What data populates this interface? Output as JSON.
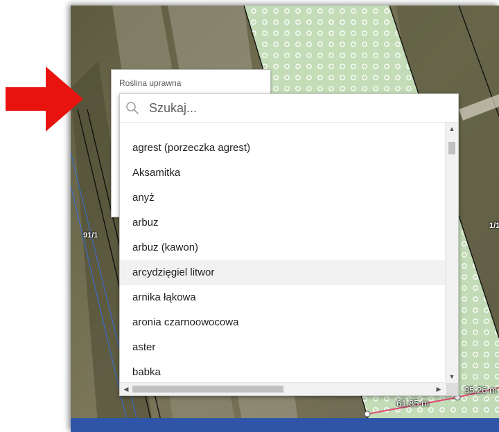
{
  "map": {
    "parcel_labels": [
      "91/1",
      "1/1"
    ],
    "measure_labels": [
      "61.85 m",
      "35.26 m"
    ]
  },
  "crop_field": {
    "label": "Roślina uprawna"
  },
  "dropdown": {
    "search_placeholder": "Szukaj...",
    "options": [
      "agrest (porzeczka agrest)",
      "Aksamitka",
      "anyż",
      "arbuz",
      "arbuz (kawon)",
      "arcydzięgiel litwor",
      "arnika łąkowa",
      "aronia czarnoowocowa",
      "aster",
      "babka"
    ],
    "hovered_option": "arcydzięgiel litwor"
  },
  "icons": {
    "search": "search-icon",
    "pointer": "red-arrow-icon"
  },
  "colors": {
    "arrow": "#e8130f",
    "bottom_bar": "#2f55a8",
    "field_highlight": "#cbe6c0"
  }
}
